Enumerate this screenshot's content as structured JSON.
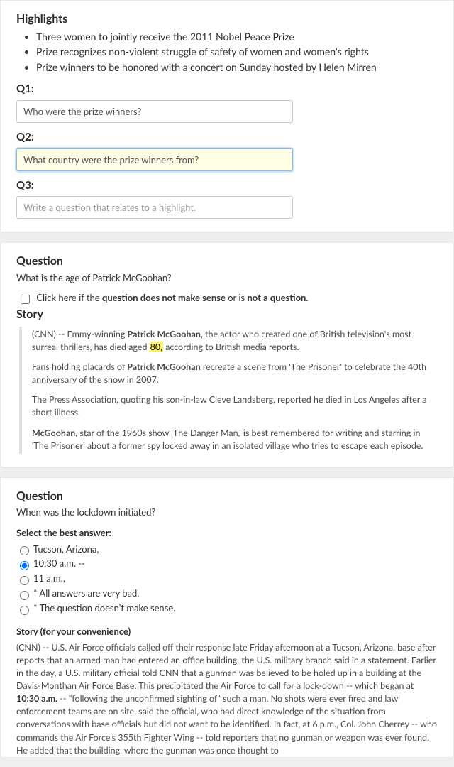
{
  "card1": {
    "highlights_title": "Highlights",
    "highlights": [
      "Three women to jointly receive the 2011 Nobel Peace Prize",
      "Prize recognizes non-violent struggle of safety of women and women's rights",
      "Prize winners to be honored with a concert on Sunday hosted by Helen Mirren"
    ],
    "q1_label": "Q1:",
    "q1_value": "Who were the prize winners?",
    "q2_label": "Q2:",
    "q2_value": "What country were the prize winners from?",
    "q3_label": "Q3:",
    "q3_placeholder": "Write a question that relates to a highlight."
  },
  "card2": {
    "question_title": "Question",
    "question_text": "What is the age of Patrick McGoohan?",
    "check_pre": "Click here if the ",
    "check_strong1": "question does not make sense",
    "check_mid": " or is ",
    "check_strong2": "not a question",
    "check_post": ".",
    "story_title": "Story",
    "p1_a": "(CNN) -- Emmy-winning ",
    "p1_b": "Patrick McGoohan,",
    "p1_c": " the actor who created one of British television's most surreal thrillers, has died aged ",
    "p1_age": "80,",
    "p1_d": " according to British media reports.",
    "p2_a": "Fans holding placards of ",
    "p2_b": "Patrick McGoohan",
    "p2_c": " recreate a scene from 'The Prisoner' to celebrate the 40th anniversary of the show in 2007.",
    "p3": "The Press Association, quoting his son-in-law Cleve Landsberg, reported he died in Los Angeles after a short illness.",
    "p4_a": "McGoohan,",
    "p4_b": " star of the 1960s show 'The Danger Man,' is best remembered for writing and starring in 'The Prisoner' about a former spy locked away in an isolated village who tries to escape each episode."
  },
  "card3": {
    "question_title": "Question",
    "question_text": "When was the lockdown initiated?",
    "select_prompt": "Select the best answer:",
    "options": [
      "Tucson, Arizona,",
      "10:30 a.m. --",
      "11 a.m.,",
      "* All answers are very bad.",
      "* The question doesn't make sense."
    ],
    "selected_index": 1,
    "story_head": "Story (for your convenience)",
    "s_a": "(CNN) -- U.S. Air Force officials called off their response late Friday afternoon at a Tucson, Arizona, base after reports that an armed man had entered an office building, the U.S. military branch said in a statement. Earlier in the day, a U.S. military official told CNN that a gunman was believed to be holed up in a building at the Davis-Monthan Air Force Base. This precipitated the Air Force to call for a lock-down -- which began at ",
    "s_b": "10:30 a.m.",
    "s_c": " -- \"following the unconfirmed sighting of\" such a man. No shots were ever fired and law enforcement teams are on site, said the official, who had direct knowledge of the situation from conversations with base officials but did not want to be identified. In fact, at 6 p.m., Col. John Cherrey -- who commands the Air Force's 355th Fighter Wing -- told reporters that no gunman or weapon was ever found. He added that the building, where the gunman was once thought to"
  }
}
